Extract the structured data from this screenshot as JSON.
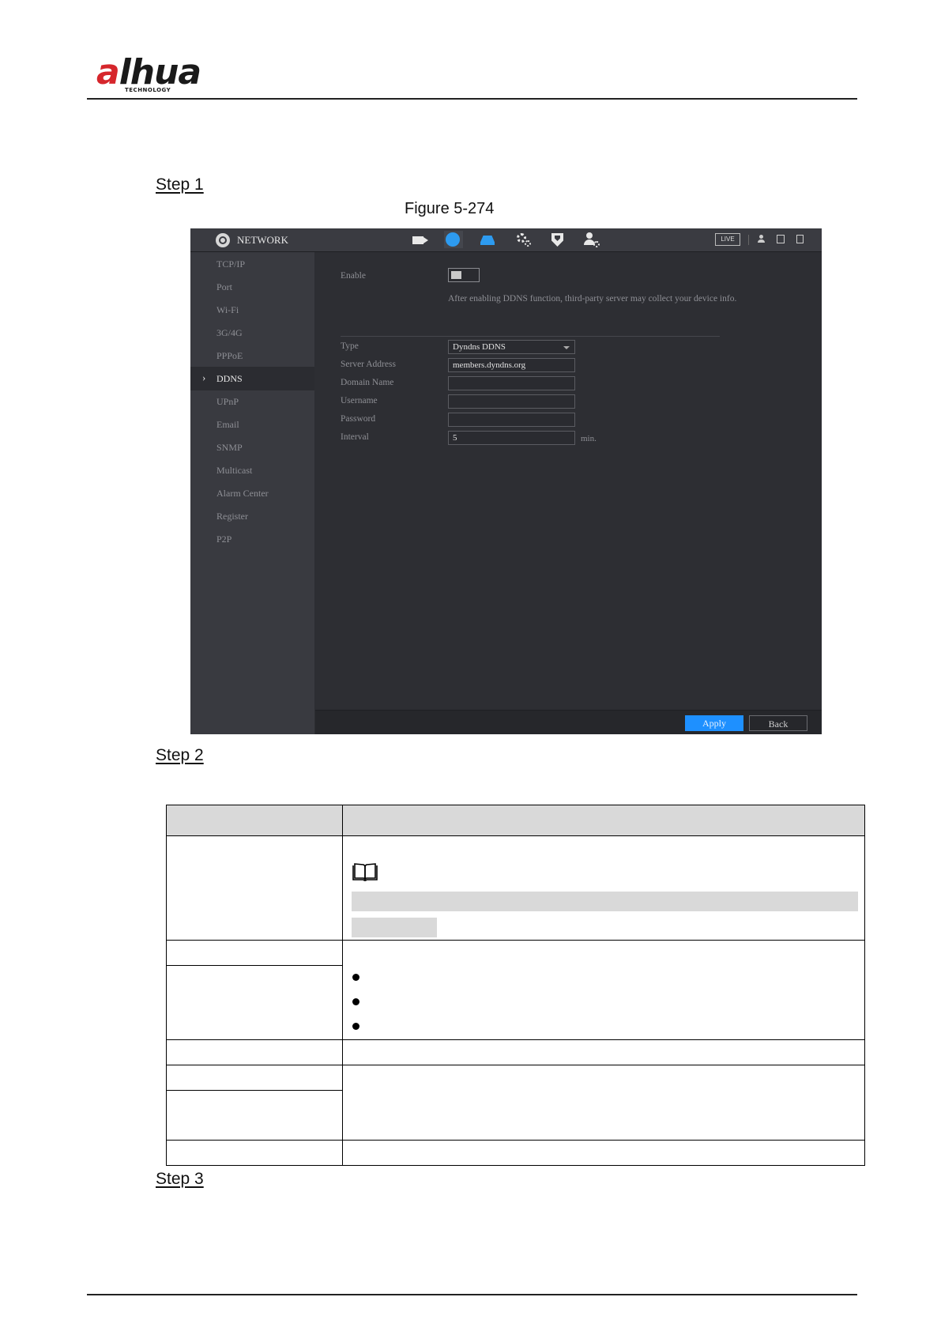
{
  "header": {
    "logo_text": "alhua",
    "logo_tagline": "TECHNOLOGY"
  },
  "steps": [
    "Step 1",
    "Step 2",
    "Step 3"
  ],
  "figure_caption": "Figure 5-274",
  "screenshot": {
    "title": "NETWORK",
    "live_label": "LIVE",
    "menu": [
      {
        "label": "TCP/IP",
        "selected": false
      },
      {
        "label": "Port",
        "selected": false
      },
      {
        "label": "Wi-Fi",
        "selected": false
      },
      {
        "label": "3G/4G",
        "selected": false
      },
      {
        "label": "PPPoE",
        "selected": false
      },
      {
        "label": "DDNS",
        "selected": true
      },
      {
        "label": "UPnP",
        "selected": false
      },
      {
        "label": "Email",
        "selected": false
      },
      {
        "label": "SNMP",
        "selected": false
      },
      {
        "label": "Multicast",
        "selected": false
      },
      {
        "label": "Alarm Center",
        "selected": false
      },
      {
        "label": "Register",
        "selected": false
      },
      {
        "label": "P2P",
        "selected": false
      }
    ],
    "form": {
      "enable_label": "Enable",
      "enable_on": false,
      "notice": "After enabling DDNS function, third-party server may collect your device info.",
      "type_label": "Type",
      "type_value": "Dyndns DDNS",
      "server_label": "Server Address",
      "server_value": "members.dyndns.org",
      "domain_label": "Domain Name",
      "domain_value": "",
      "username_label": "Username",
      "username_value": "",
      "password_label": "Password",
      "password_value": "",
      "interval_label": "Interval",
      "interval_value": "5",
      "interval_unit": "min."
    },
    "buttons": {
      "apply": "Apply",
      "back": "Back"
    },
    "colors": {
      "accent": "#1e90ff",
      "panel": "#2d2e33",
      "sidebar": "#393a40"
    }
  }
}
